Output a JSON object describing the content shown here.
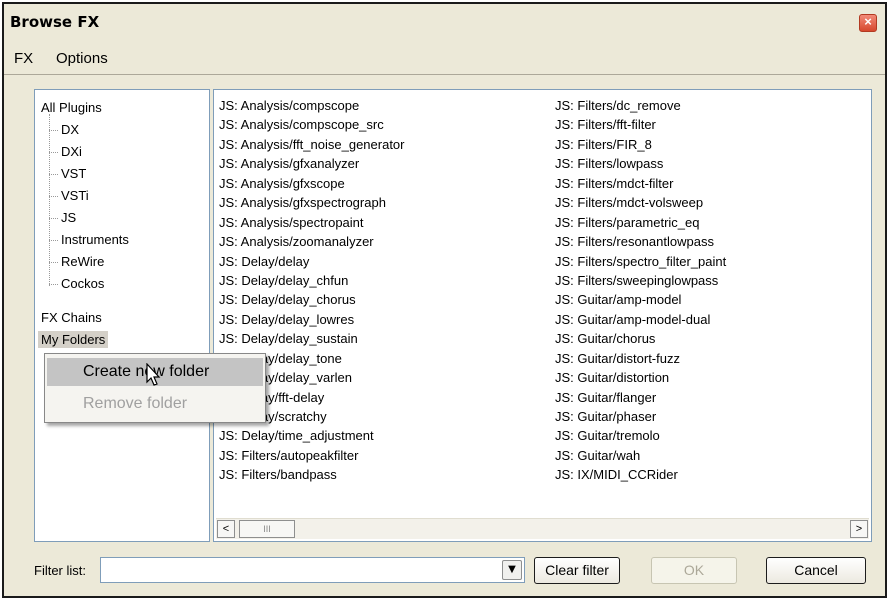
{
  "window": {
    "title": "Browse FX",
    "close_label": "x"
  },
  "menu": [
    "FX",
    "Options"
  ],
  "tree": {
    "root": "All Plugins",
    "children": [
      "DX",
      "DXi",
      "VST",
      "VSTi",
      "JS",
      "Instruments",
      "ReWire",
      "Cockos"
    ],
    "fx_chains": "FX Chains",
    "my_folders": "My Folders"
  },
  "list": {
    "col1": [
      "JS: Analysis/compscope",
      "JS: Analysis/compscope_src",
      "JS: Analysis/fft_noise_generator",
      "JS: Analysis/gfxanalyzer",
      "JS: Analysis/gfxscope",
      "JS: Analysis/gfxspectrograph",
      "JS: Analysis/spectropaint",
      "JS: Analysis/zoomanalyzer",
      "JS: Delay/delay",
      "JS: Delay/delay_chfun",
      "JS: Delay/delay_chorus",
      "JS: Delay/delay_lowres",
      "JS: Delay/delay_sustain",
      "JS: Delay/delay_tone",
      "JS: Delay/delay_varlen",
      "JS: Delay/fft-delay",
      "JS: Delay/scratchy",
      "JS: Delay/time_adjustment",
      "JS: Filters/autopeakfilter",
      "JS: Filters/bandpass"
    ],
    "col2": [
      "JS: Filters/dc_remove",
      "JS: Filters/fft-filter",
      "JS: Filters/FIR_8",
      "JS: Filters/lowpass",
      "JS: Filters/mdct-filter",
      "JS: Filters/mdct-volsweep",
      "JS: Filters/parametric_eq",
      "JS: Filters/resonantlowpass",
      "JS: Filters/spectro_filter_paint",
      "JS: Filters/sweepinglowpass",
      "JS: Guitar/amp-model",
      "JS: Guitar/amp-model-dual",
      "JS: Guitar/chorus",
      "JS: Guitar/distort-fuzz",
      "JS: Guitar/distortion",
      "JS: Guitar/flanger",
      "JS: Guitar/phaser",
      "JS: Guitar/tremolo",
      "JS: Guitar/wah",
      "JS: IX/MIDI_CCRider"
    ],
    "scroll_left": "<",
    "scroll_right": ">",
    "thumb_grip": "III"
  },
  "context_menu": {
    "items": [
      {
        "label": "Create new folder",
        "enabled": true
      },
      {
        "label": "Remove folder",
        "enabled": false
      }
    ]
  },
  "filter": {
    "label": "Filter list:",
    "value": ""
  },
  "buttons": {
    "clear": "Clear filter",
    "ok": "OK",
    "cancel": "Cancel"
  }
}
